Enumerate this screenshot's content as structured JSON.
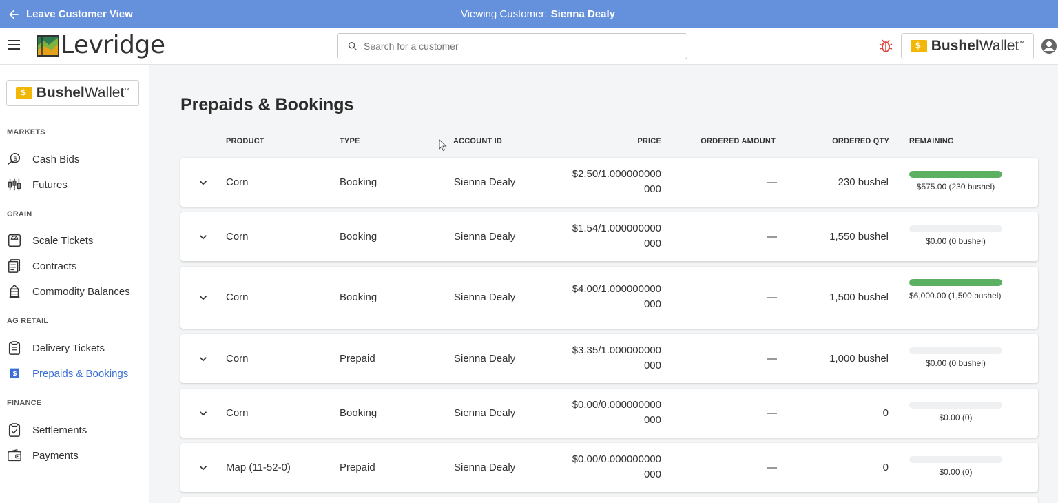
{
  "banner": {
    "leave_label": "Leave Customer View",
    "viewing_prefix": "Viewing Customer:",
    "customer_name": "Sienna Dealy"
  },
  "header": {
    "logo_text": "Levridge",
    "search_placeholder": "Search for a customer",
    "wallet_bold": "Bushel",
    "wallet_rest": "Wallet",
    "wallet_tm": "™"
  },
  "sidebar": {
    "wallet_bold": "Bushel",
    "wallet_rest": "Wallet",
    "wallet_tm": "™",
    "sections": {
      "markets": "MARKETS",
      "grain": "GRAIN",
      "ag_retail": "AG RETAIL",
      "finance": "FINANCE"
    },
    "items": {
      "cash_bids": "Cash Bids",
      "futures": "Futures",
      "scale_tickets": "Scale Tickets",
      "contracts": "Contracts",
      "commodity_balances": "Commodity Balances",
      "delivery_tickets": "Delivery Tickets",
      "prepaids_bookings": "Prepaids & Bookings",
      "settlements": "Settlements",
      "payments": "Payments"
    },
    "active_color": "#3b6fd4"
  },
  "main": {
    "title": "Prepaids & Bookings",
    "columns": {
      "product": "PRODUCT",
      "type": "TYPE",
      "account_id": "ACCOUNT ID",
      "price": "PRICE",
      "ordered_amount": "ORDERED AMOUNT",
      "ordered_qty": "ORDERED QTY",
      "remaining": "REMAINING"
    },
    "rows": [
      {
        "product": "Corn",
        "type": "Booking",
        "account": "Sienna Dealy",
        "price_line1": "$2.50/1.000000000",
        "price_line2": "000",
        "ordered_amount": "—",
        "ordered_qty": "230 bushel",
        "remaining_fraction": 1.0,
        "remaining_text": "$575.00 (230 bushel)"
      },
      {
        "product": "Corn",
        "type": "Booking",
        "account": "Sienna Dealy",
        "price_line1": "$1.54/1.000000000",
        "price_line2": "000",
        "ordered_amount": "—",
        "ordered_qty": "1,550 bushel",
        "remaining_fraction": 0,
        "remaining_text": "$0.00 (0 bushel)"
      },
      {
        "product": "Corn",
        "type": "Booking",
        "account": "Sienna Dealy",
        "price_line1": "$4.00/1.000000000",
        "price_line2": "000",
        "ordered_amount": "—",
        "ordered_qty": "1,500 bushel",
        "remaining_fraction": 1.0,
        "remaining_text": "$6,000.00 (1,500 bushel)"
      },
      {
        "product": "Corn",
        "type": "Prepaid",
        "account": "Sienna Dealy",
        "price_line1": "$3.35/1.000000000",
        "price_line2": "000",
        "ordered_amount": "—",
        "ordered_qty": "1,000 bushel",
        "remaining_fraction": 0,
        "remaining_text": "$0.00 (0 bushel)"
      },
      {
        "product": "Corn",
        "type": "Booking",
        "account": "Sienna Dealy",
        "price_line1": "$0.00/0.000000000",
        "price_line2": "000",
        "ordered_amount": "—",
        "ordered_qty": "0",
        "remaining_fraction": 0,
        "remaining_text": "$0.00 (0)"
      },
      {
        "product": "Map (11-52-0)",
        "type": "Prepaid",
        "account": "Sienna Dealy",
        "price_line1": "$0.00/0.000000000",
        "price_line2": "000",
        "ordered_amount": "—",
        "ordered_qty": "0",
        "remaining_fraction": 0,
        "remaining_text": "$0.00 (0)"
      }
    ]
  },
  "colors": {
    "banner": "#6590dc",
    "progress_fill": "#5cb061",
    "progress_track": "#eef0f1",
    "bug_icon": "#e0443c",
    "wallet_yellow": "#f2b705"
  }
}
